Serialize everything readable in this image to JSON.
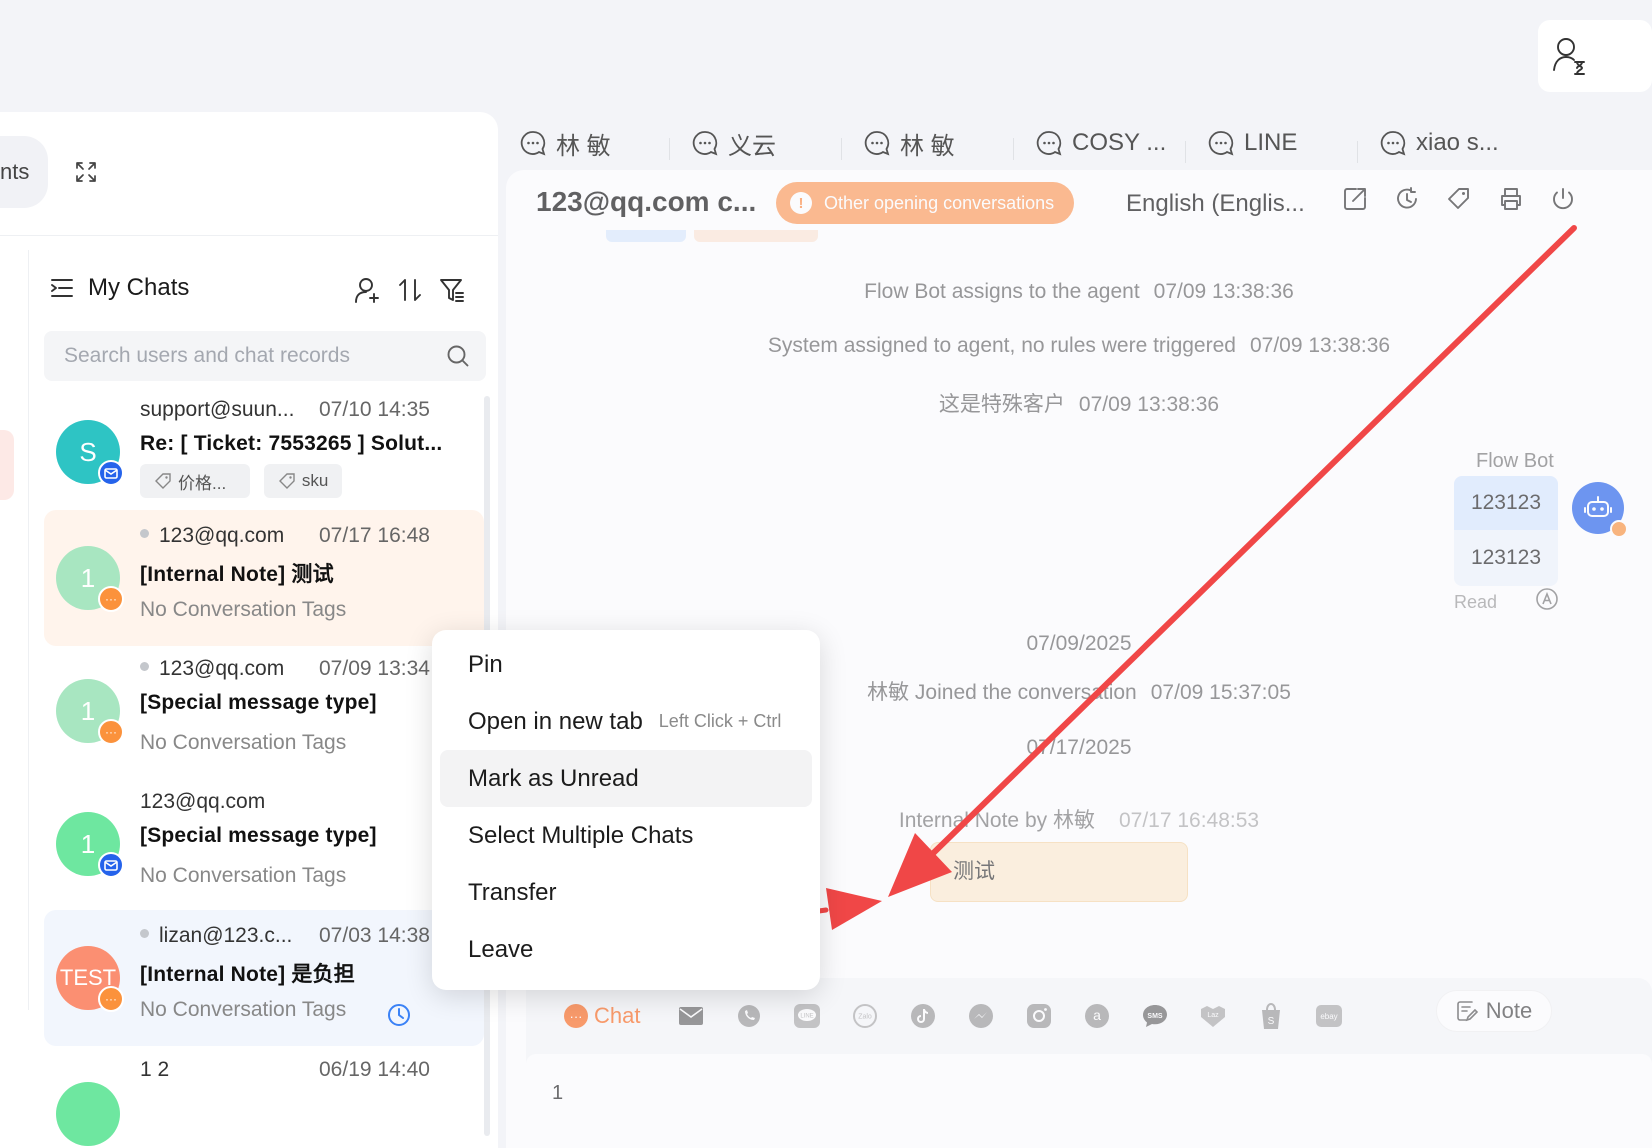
{
  "left_panel": {
    "tab_fragment": "nts",
    "title": "My Chats",
    "search_placeholder": "Search users and chat records",
    "chats": [
      {
        "avatar": "S",
        "avatar_color": "#2ec4c4",
        "channel": "email",
        "name": "support@suun...",
        "time": "07/10 14:35",
        "subject": "Re: [ Ticket: 7553265 ] Solut...",
        "tags": [
          "价格...",
          "sku"
        ],
        "unread_dot": false
      },
      {
        "avatar": "1",
        "avatar_color": "#a8e6c1",
        "channel": "chat",
        "name": "123@qq.com",
        "time": "07/17 16:48",
        "subject": "[Internal Note] 测试",
        "tag_text": "No Conversation Tags",
        "unread_dot": true
      },
      {
        "avatar": "1",
        "avatar_color": "#a8e6c1",
        "channel": "chat",
        "name": "123@qq.com",
        "time": "07/09 13:34",
        "subject": "[Special message type]",
        "tag_text": "No Conversation Tags",
        "unread_dot": true
      },
      {
        "avatar": "1",
        "avatar_color": "#6ee7a0",
        "channel": "email",
        "name": "123@qq.com",
        "time": "",
        "subject": "[Special message type]",
        "tag_text": "No Conversation Tags",
        "unread_dot": false
      },
      {
        "avatar": "TEST",
        "avatar_color": "#fb8f72",
        "channel": "chat",
        "name": "lizan@123.c...",
        "time": "07/03 14:38",
        "subject": "[Internal Note] 是负担",
        "tag_text": "No Conversation Tags",
        "unread_dot": true
      },
      {
        "avatar": "",
        "avatar_color": "#6ee7a0",
        "channel": "",
        "name": "1 2",
        "time": "06/19 14:40",
        "subject": "",
        "tag_text": "",
        "unread_dot": false
      }
    ]
  },
  "tabs": [
    "林 敏",
    "义云",
    "林 敏",
    "COSY ...",
    "LINE",
    "xiao s..."
  ],
  "conversation": {
    "contact": "123@qq.com c...",
    "other_conversations_label": "Other opening conversations",
    "language": "English (Englis...",
    "events": [
      {
        "text": "Flow Bot assigns to the agent",
        "time": "07/09 13:38:36"
      },
      {
        "text": "System assigned to agent, no rules were triggered",
        "time": "07/09 13:38:36"
      },
      {
        "text": "这是特殊客户",
        "time": "07/09 13:38:36"
      }
    ],
    "bot_name": "Flow Bot",
    "bot_message_1": "123123",
    "bot_message_2": "123123",
    "read_label": "Read",
    "date_1": "07/09/2025",
    "joined_text": "林敏 Joined the conversation",
    "joined_time": "07/09 15:37:05",
    "date_2": "07/17/2025",
    "note_header": "Internal Note by 林敏",
    "note_time": "07/17 16:48:53",
    "note_text": "测试"
  },
  "composer": {
    "chat_tab": "Chat",
    "note_button": "Note",
    "editor_text": "1",
    "channels": [
      "email-icon",
      "whatsapp-icon",
      "line-icon",
      "zalo-icon",
      "tiktok-icon",
      "messenger-icon",
      "instagram-icon",
      "amazon-icon",
      "sms-icon",
      "lazada-icon",
      "shopify-icon",
      "ebay-icon"
    ]
  },
  "context_menu": {
    "items": [
      {
        "label": "Pin",
        "hint": ""
      },
      {
        "label": "Open in new tab",
        "hint": "Left Click + Ctrl"
      },
      {
        "label": "Mark as Unread",
        "hint": ""
      },
      {
        "label": "Select Multiple Chats",
        "hint": ""
      },
      {
        "label": "Transfer",
        "hint": ""
      },
      {
        "label": "Leave",
        "hint": ""
      }
    ],
    "highlighted_index": 2
  },
  "colors": {
    "accent_orange": "#fb6b1f",
    "arrow_red": "#f04747",
    "brand_blue": "#2563eb"
  }
}
